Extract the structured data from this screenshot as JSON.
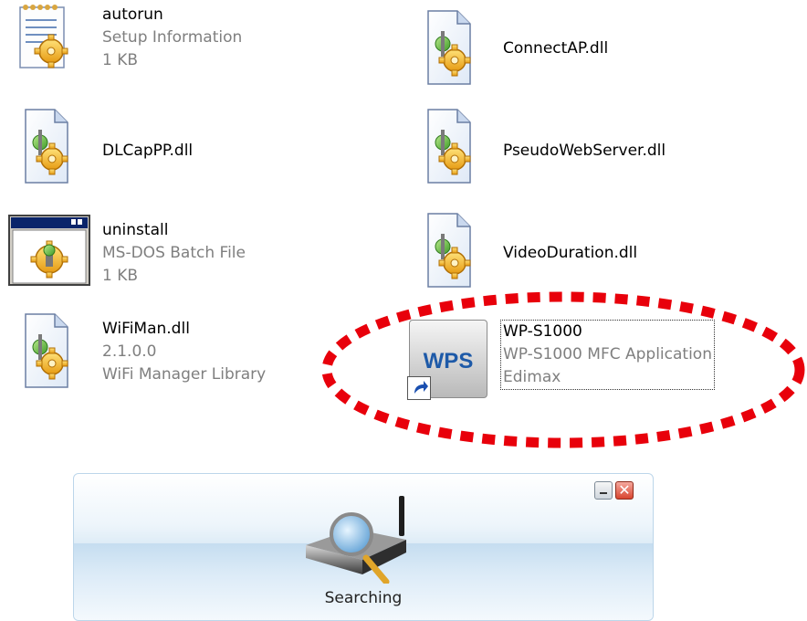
{
  "files": [
    {
      "id": "autorun",
      "name": "autorun",
      "lines": [
        "Setup Information",
        "1 KB"
      ],
      "icon": "setup-information-icon"
    },
    {
      "id": "connectap",
      "name": "ConnectAP.dll",
      "lines": [],
      "icon": "dll-file-icon"
    },
    {
      "id": "dlcappp",
      "name": "DLCapPP.dll",
      "lines": [],
      "icon": "dll-file-icon"
    },
    {
      "id": "pseudowebserver",
      "name": "PseudoWebServer.dll",
      "lines": [],
      "icon": "dll-file-icon"
    },
    {
      "id": "uninstall",
      "name": "uninstall",
      "lines": [
        "MS-DOS Batch File",
        "1 KB"
      ],
      "icon": "batch-file-icon"
    },
    {
      "id": "videoduration",
      "name": "VideoDuration.dll",
      "lines": [],
      "icon": "dll-file-icon"
    },
    {
      "id": "wifiman",
      "name": "WiFiMan.dll",
      "lines": [
        "2.1.0.0",
        "WiFi Manager Library"
      ],
      "icon": "dll-file-icon"
    },
    {
      "id": "wps",
      "name": "WP-S1000",
      "lines": [
        "WP-S1000 MFC Application",
        "Edimax"
      ],
      "icon": "wps-shortcut-icon"
    }
  ],
  "wps_icon_label": "WPS",
  "highlight_color": "#e8000b",
  "widget": {
    "status_text": "Searching",
    "minimize_icon": "minimize-icon",
    "close_icon": "close-icon",
    "close_glyph": "✕"
  }
}
